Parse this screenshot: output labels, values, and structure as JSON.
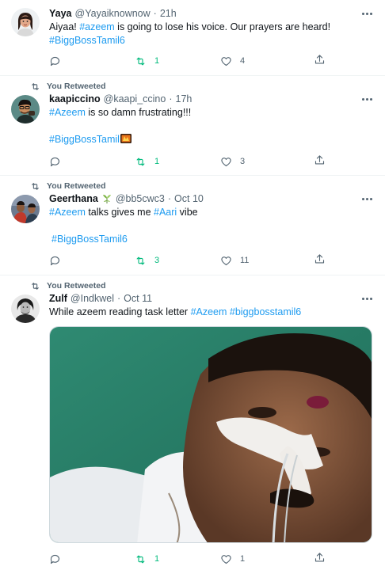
{
  "tweets": [
    {
      "retweeted": false,
      "name": "Yaya",
      "handle": "@Yayaiknownow",
      "time": "21h",
      "text_parts": [
        "Aiyaa! ",
        "#azeem",
        " is going to lose his voice. Our prayers are heard!"
      ],
      "hashtag_line": "#BiggBossTamil6",
      "replies": "",
      "retweets": "1",
      "likes": "4"
    },
    {
      "retweeted": true,
      "retweet_label": "You Retweeted",
      "name": "kaapiccino",
      "handle": "@kaapi_ccino",
      "time": "17h",
      "text_parts": [
        "#Azeem",
        " is so damn frustrating!!!"
      ],
      "hashtag_line": "#BiggBossTamil",
      "replies": "",
      "retweets": "1",
      "likes": "3"
    },
    {
      "retweeted": true,
      "retweet_label": "You Retweeted",
      "name": "Geerthana",
      "handle": "@bb5cwc3",
      "time": "Oct 10",
      "text_parts": [
        "#Azeem",
        " talks gives me ",
        "#Aari",
        " vibe"
      ],
      "hashtag_line": "#BiggBossTamil6",
      "replies": "",
      "retweets": "3",
      "likes": "11"
    },
    {
      "retweeted": true,
      "retweet_label": "You Retweeted",
      "name": "Zulf",
      "handle": "@Indkwel",
      "time": "Oct 11",
      "text_parts": [
        "While azeem reading task letter ",
        "#Azeem",
        " ",
        "#biggbosstamil6"
      ],
      "replies": "",
      "retweets": "1",
      "likes": "1"
    }
  ],
  "separator": "·",
  "colors": {
    "link": "#1d9bf0",
    "muted": "#536471",
    "retweet_active": "#00ba7c",
    "text": "#0f1419"
  },
  "icons": [
    "more-icon",
    "reply-icon",
    "retweet-icon",
    "like-icon",
    "share-icon"
  ]
}
